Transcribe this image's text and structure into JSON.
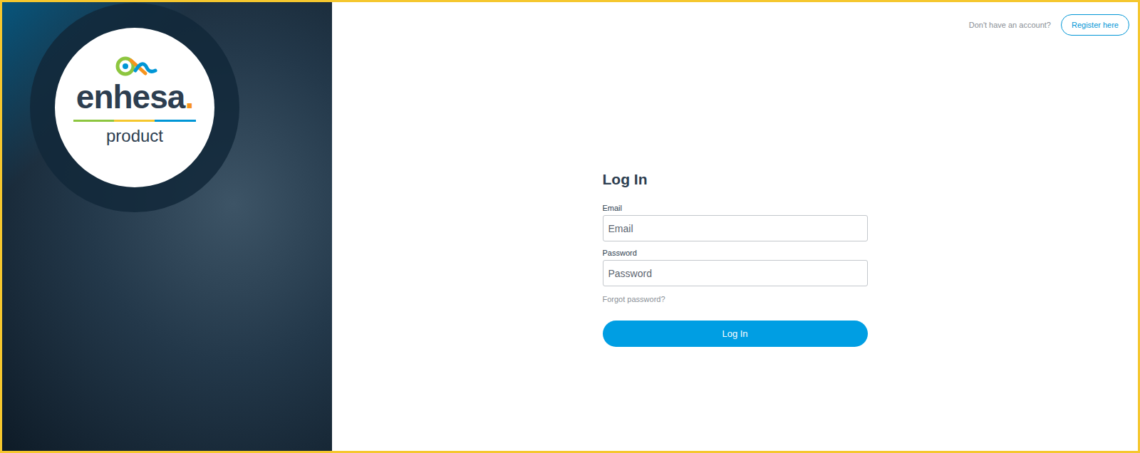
{
  "brand": {
    "name": "enhesa",
    "dot": ".",
    "subtitle": "product"
  },
  "header": {
    "prompt": "Don't have an account?",
    "register_button": "Register here"
  },
  "form": {
    "title": "Log In",
    "fields": [
      {
        "label": "Email",
        "placeholder": "Email",
        "kind": "text"
      },
      {
        "label": "Password",
        "placeholder": "Password",
        "kind": "password"
      }
    ],
    "forgot_link": "Forgot password?",
    "submit_button": "Log In"
  }
}
